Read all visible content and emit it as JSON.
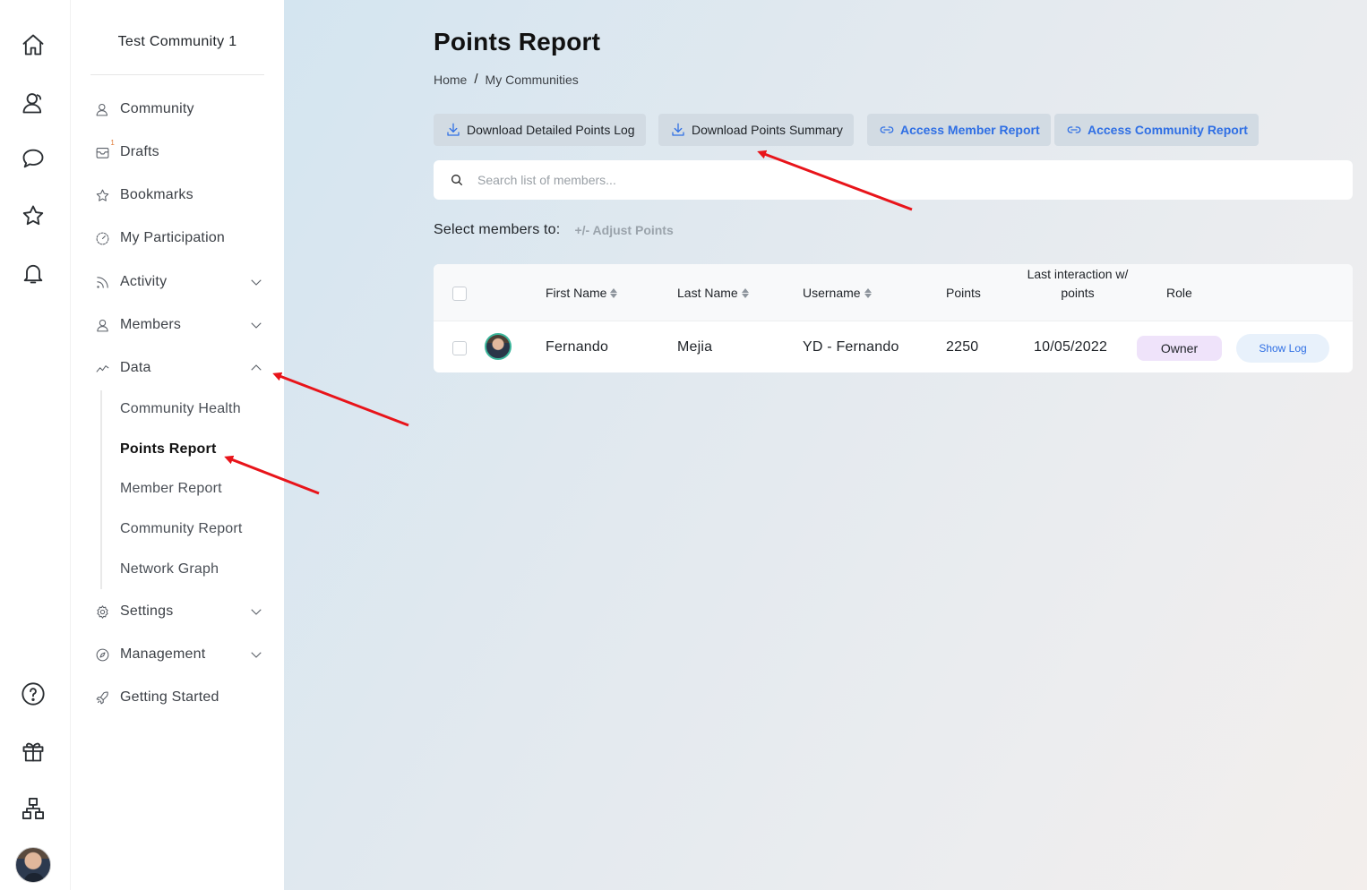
{
  "rail": {
    "icons": [
      "home-icon",
      "user-group-icon",
      "chat-bubble-icon",
      "star-icon",
      "bell-icon",
      "help-circle-icon",
      "gift-icon",
      "org-chart-icon"
    ]
  },
  "sidebar": {
    "community_name": "Test Community 1",
    "items": {
      "community": "Community",
      "drafts": "Drafts",
      "drafts_badge": "1",
      "bookmarks": "Bookmarks",
      "participation": "My Participation",
      "activity": "Activity",
      "members": "Members",
      "data": "Data",
      "settings": "Settings",
      "management": "Management",
      "getting_started": "Getting Started"
    },
    "data_sub": {
      "health": "Community Health",
      "points": "Points Report",
      "member_report": "Member Report",
      "community_report": "Community Report",
      "network": "Network Graph"
    }
  },
  "main": {
    "title": "Points Report",
    "breadcrumb": {
      "home": "Home",
      "sep": "/",
      "current": "My Communities"
    },
    "actions": {
      "download_log": "Download Detailed Points Log",
      "download_summary": "Download Points Summary",
      "member_report": "Access Member Report",
      "community_report": "Access Community Report"
    },
    "search": {
      "placeholder": "Search list of members..."
    },
    "select_label": "Select members to:",
    "adjust_points": "+/- Adjust Points",
    "table": {
      "headers": {
        "first_name": "First Name",
        "last_name": "Last Name",
        "username": "Username",
        "points": "Points",
        "last_interaction": "Last interaction w/ points",
        "role": "Role"
      },
      "rows": [
        {
          "first_name": "Fernando",
          "last_name": "Mejia",
          "username": "YD - Fernando",
          "points": "2250",
          "last_interaction": "10/05/2022",
          "role": "Owner",
          "action": "Show Log"
        }
      ]
    }
  },
  "colors": {
    "accent": "#2f6fe4",
    "annotation_arrow": "#e8141a",
    "role_pill": "#efe3fa"
  }
}
